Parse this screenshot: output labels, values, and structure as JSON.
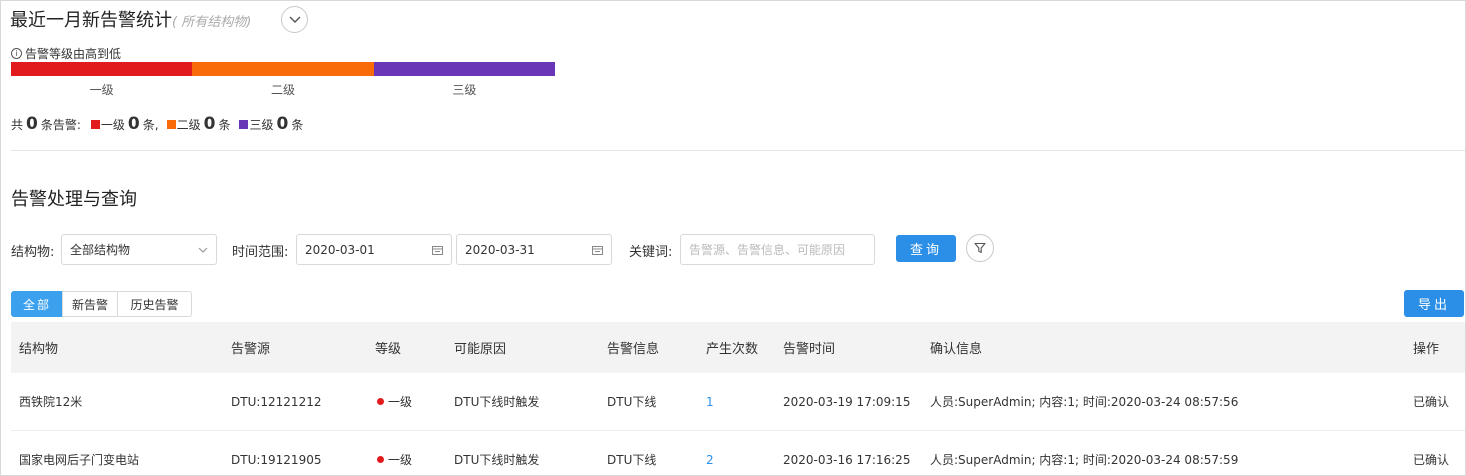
{
  "stats": {
    "title": "最近一月新告警统计",
    "subtitle": "( 所有结构物)",
    "hint": "告警等级由高到低",
    "levels": [
      {
        "label": "一级",
        "color": "#e11b1b"
      },
      {
        "label": "二级",
        "color": "#f96a08"
      },
      {
        "label": "三级",
        "color": "#6a36b8"
      }
    ],
    "summary": {
      "total_prefix": "共",
      "total_count": "0",
      "total_suffix": "条告警:",
      "items": [
        {
          "label": "一级",
          "count": "0",
          "unit": "条,"
        },
        {
          "label": "二级",
          "count": "0",
          "unit": "条"
        },
        {
          "label": "三级",
          "count": "0",
          "unit": "条"
        }
      ]
    }
  },
  "query": {
    "title": "告警处理与查询",
    "structure_label": "结构物:",
    "structure_value": "全部结构物",
    "time_label": "时间范围:",
    "date_start": "2020-03-01",
    "date_end": "2020-03-31",
    "keyword_label": "关键词:",
    "keyword_placeholder": "告警源、告警信息、可能原因",
    "query_button": "查询"
  },
  "tabs": [
    "全部",
    "新告警",
    "历史告警"
  ],
  "export_button": "导出",
  "table": {
    "headers": [
      "结构物",
      "告警源",
      "等级",
      "可能原因",
      "告警信息",
      "产生次数",
      "告警时间",
      "确认信息",
      "操作"
    ],
    "rows": [
      {
        "structure": "西铁院12米",
        "source": "DTU:12121212",
        "level": "一级",
        "cause": "DTU下线时触发",
        "info": "DTU下线",
        "count": "1",
        "time": "2020-03-19 17:09:15",
        "confirm": "人员:SuperAdmin; 内容:1; 时间:2020-03-24 08:57:56",
        "action": "已确认"
      },
      {
        "structure": "国家电网后子门变电站",
        "source": "DTU:19121905",
        "level": "一级",
        "cause": "DTU下线时触发",
        "info": "DTU下线",
        "count": "2",
        "time": "2020-03-16 17:16:25",
        "confirm": "人员:SuperAdmin; 内容:1; 时间:2020-03-24 08:57:59",
        "action": "已确认"
      }
    ]
  }
}
